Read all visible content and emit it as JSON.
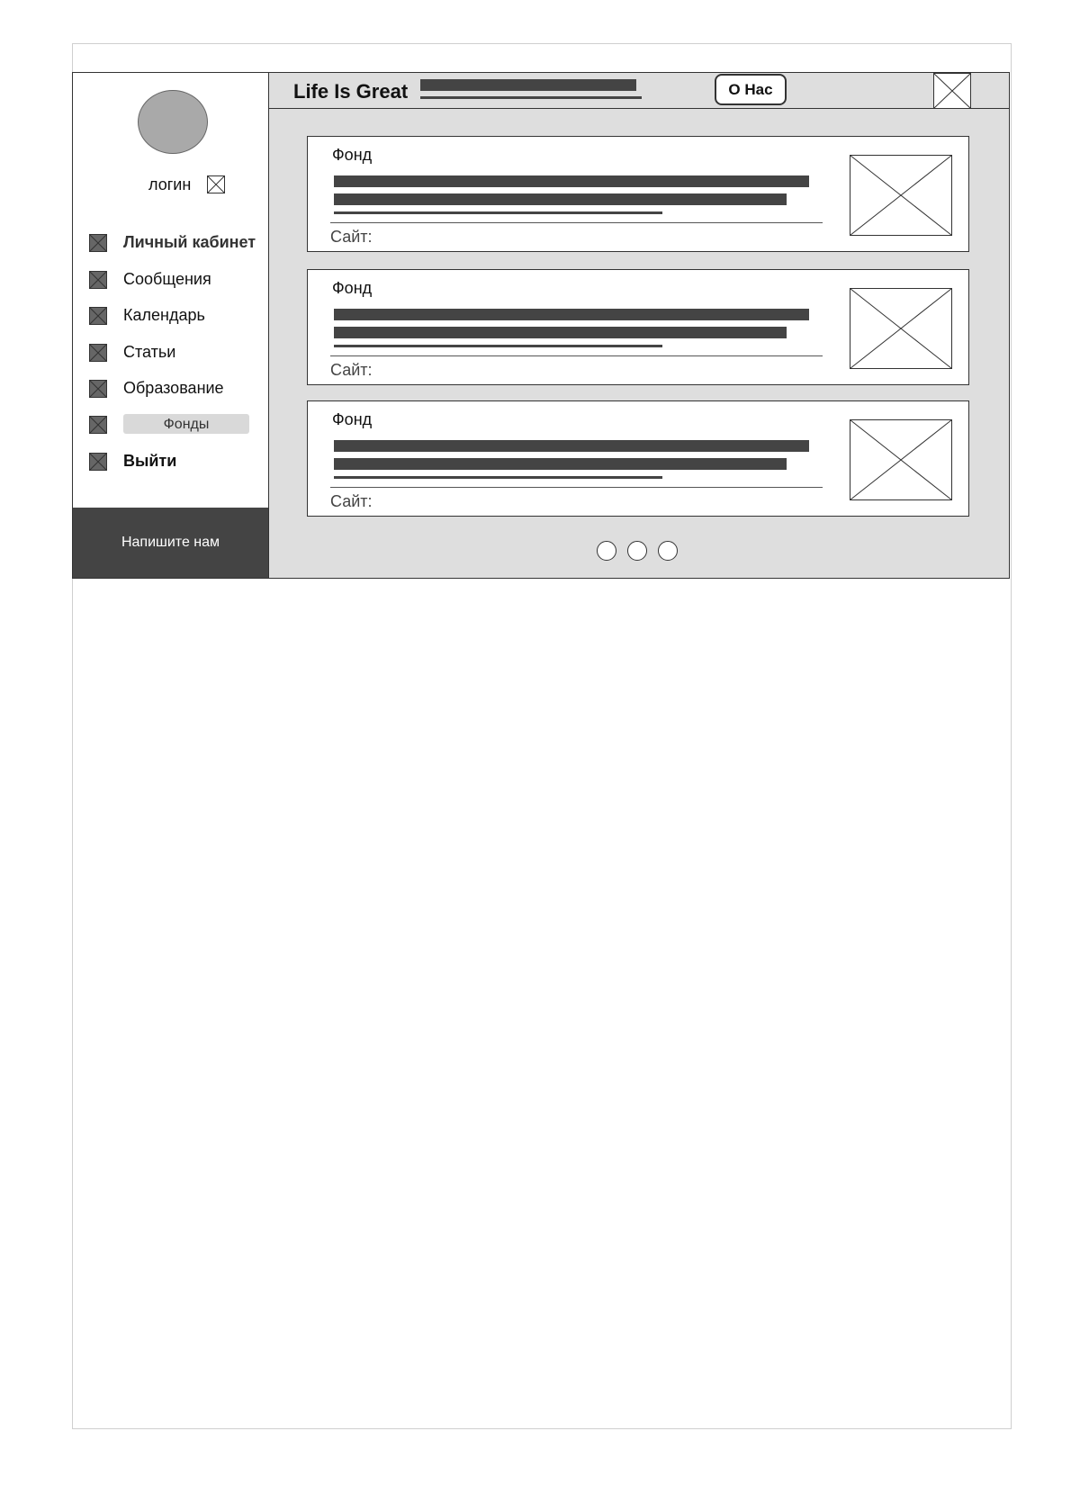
{
  "header": {
    "brand": "Life Is Great",
    "about_label": "О Нас"
  },
  "sidebar": {
    "login_label": "логин",
    "items": [
      {
        "label": "Личный кабинет"
      },
      {
        "label": "Сообщения"
      },
      {
        "label": "Календарь"
      },
      {
        "label": "Статьи"
      },
      {
        "label": "Образование"
      },
      {
        "label": "Фонды"
      },
      {
        "label": "Выйти"
      }
    ],
    "contact_label": "Напишите нам"
  },
  "cards": [
    {
      "title": "Фонд",
      "site_label": "Сайт:"
    },
    {
      "title": "Фонд",
      "site_label": "Сайт:"
    },
    {
      "title": "Фонд",
      "site_label": "Сайт:"
    }
  ],
  "pagination": {
    "count": 3
  },
  "icons": {
    "nav_icon": "placeholder-x-icon",
    "image_placeholder": "image-placeholder-icon"
  }
}
